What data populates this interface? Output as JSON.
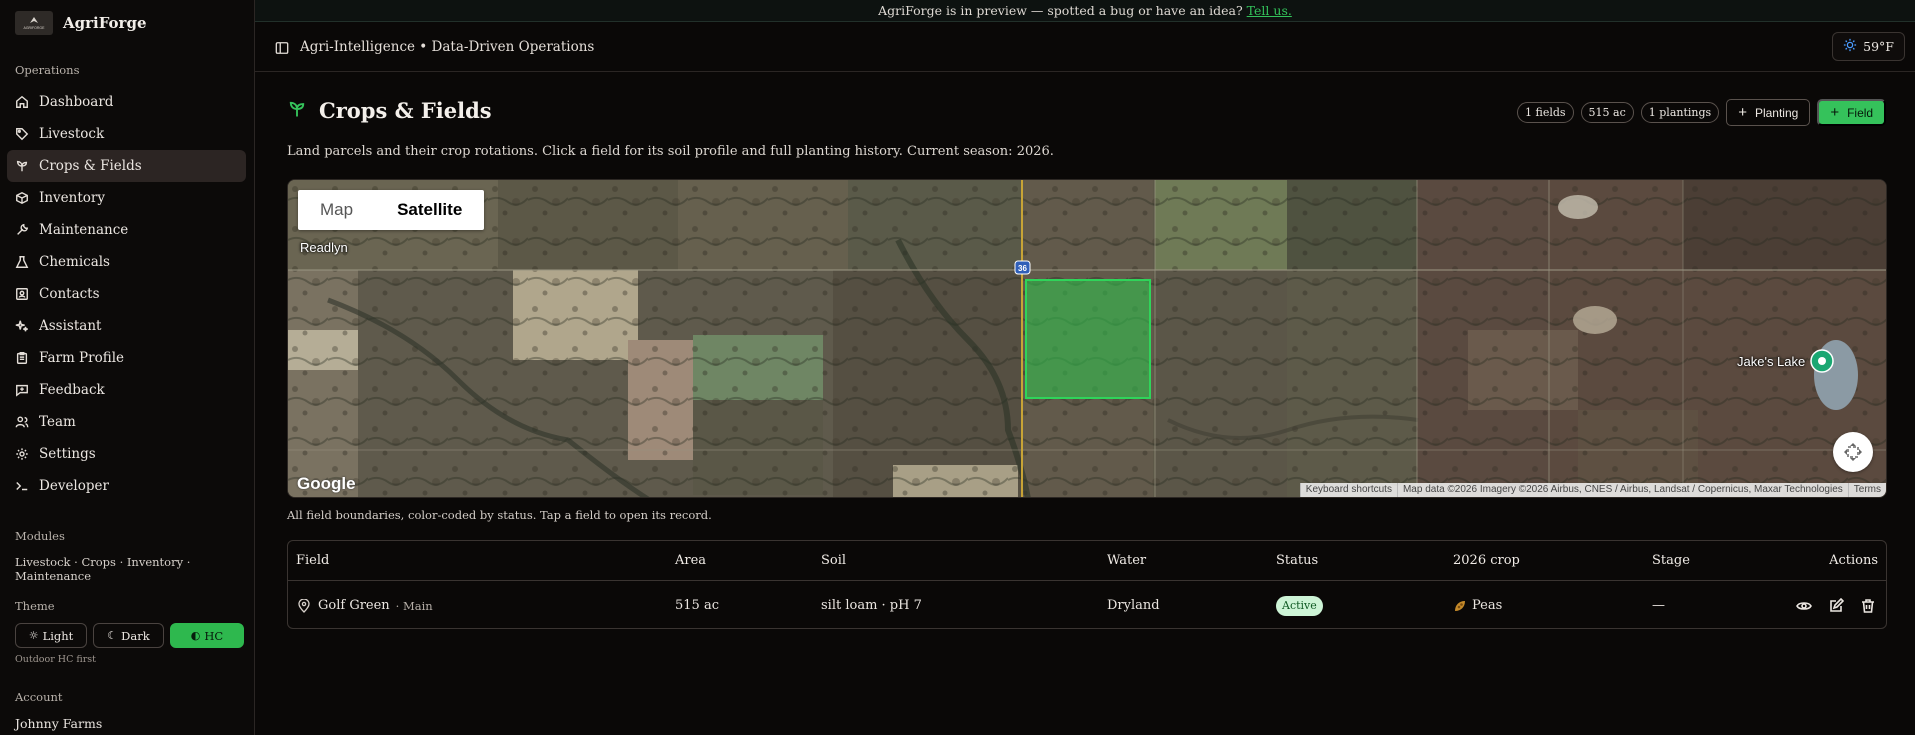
{
  "brand": {
    "name": "AgriForge",
    "logo_text": "AGRIFORGE"
  },
  "sidebar": {
    "operations_label": "Operations",
    "items": [
      {
        "label": "Dashboard",
        "icon": "home-icon"
      },
      {
        "label": "Livestock",
        "icon": "tag-icon"
      },
      {
        "label": "Crops & Fields",
        "icon": "sprout-icon",
        "active": true
      },
      {
        "label": "Inventory",
        "icon": "box-icon"
      },
      {
        "label": "Maintenance",
        "icon": "wrench-icon"
      },
      {
        "label": "Chemicals",
        "icon": "flask-icon"
      },
      {
        "label": "Contacts",
        "icon": "contact-icon"
      },
      {
        "label": "Assistant",
        "icon": "sparkles-icon"
      },
      {
        "label": "Farm Profile",
        "icon": "clipboard-icon"
      },
      {
        "label": "Feedback",
        "icon": "message-icon"
      },
      {
        "label": "Team",
        "icon": "users-icon"
      },
      {
        "label": "Settings",
        "icon": "gear-icon"
      },
      {
        "label": "Developer",
        "icon": "terminal-icon"
      }
    ],
    "modules_label": "Modules",
    "modules_list": "Livestock · Crops · Inventory · Maintenance",
    "theme_label": "Theme",
    "theme_options": {
      "light": "Light",
      "dark": "Dark",
      "hc": "HC"
    },
    "theme_hint": "Outdoor HC first",
    "account_label": "Account",
    "account_name": "Johnny Farms"
  },
  "banner": {
    "text": "AgriForge is in preview — spotted a bug or have an idea?",
    "link": "Tell us."
  },
  "header": {
    "title": "Agri-Intelligence • Data-Driven Operations",
    "weather": "59°F"
  },
  "page": {
    "title": "Crops & Fields",
    "description": "Land parcels and their crop rotations. Click a field for its soil profile and full planting history. Current season: 2026.",
    "chips": [
      "1 fields",
      "515 ac",
      "1 plantings"
    ],
    "planting_button": "Planting",
    "field_button": "Field"
  },
  "map": {
    "toggle_map": "Map",
    "toggle_satellite": "Satellite",
    "town_label": "Readlyn",
    "lake_label": "Jake's Lake",
    "highway_shield": "36",
    "google": "Google",
    "attribution": [
      "Keyboard shortcuts",
      "Map data ©2026 Imagery ©2026 Airbus, CNES / Airbus, Landsat / Copernicus, Maxar Technologies",
      "Terms"
    ],
    "caption": "All field boundaries, color-coded by status. Tap a field to open its record."
  },
  "table": {
    "headers": {
      "field": "Field",
      "area": "Area",
      "soil": "Soil",
      "water": "Water",
      "status": "Status",
      "crop": "2026 crop",
      "stage": "Stage",
      "actions": "Actions"
    },
    "rows": [
      {
        "field": "Golf Green",
        "field_tag": "· Main",
        "area": "515 ac",
        "soil": "silt loam · pH 7",
        "water": "Dryland",
        "status": "Active",
        "crop": "Peas",
        "stage": "—"
      }
    ]
  },
  "colors": {
    "accent": "#35c25b",
    "background": "#0a0807",
    "active_nav": "#2c2523"
  }
}
